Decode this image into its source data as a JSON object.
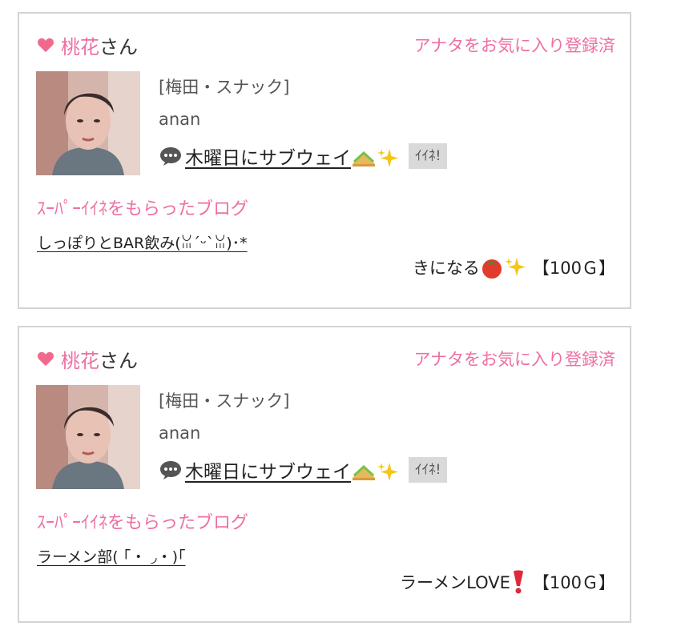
{
  "posts": [
    {
      "name_highlight": "桃花",
      "name_suffix": "さん",
      "favorite_status": "アナタをお気に入り登録済",
      "shop": "[梅田・スナック]",
      "username": "anan",
      "blog_title": "木曜日にサブウェイ",
      "like_label": "ｲｲﾈ!",
      "super_like_heading": "ｽｰﾊﾟｰｲｲﾈをもらったブログ",
      "liked_blog_link": "しっぽりとBAR飲み(ꈍ´ᵕ`ꈍ)･*",
      "gift_message": "きになる",
      "gift_amount": "【100Ｇ】",
      "gift_emoji": "tomato-icon"
    },
    {
      "name_highlight": "桃花",
      "name_suffix": "さん",
      "favorite_status": "アナタをお気に入り登録済",
      "shop": "[梅田・スナック]",
      "username": "anan",
      "blog_title": "木曜日にサブウェイ",
      "like_label": "ｲｲﾈ!",
      "super_like_heading": "ｽｰﾊﾟｰｲｲﾈをもらったブログ",
      "liked_blog_link": "ラーメン部( ｢・ ◞・)｢",
      "gift_message": "ラーメンLOVE",
      "gift_amount": "【100Ｇ】",
      "gift_emoji": "exclamation-icon"
    }
  ],
  "colors": {
    "accent_pink": "#ee6fa4",
    "heart": "#f06a8e",
    "border": "#d4d4d4",
    "like_bg": "#d9d9d9"
  }
}
